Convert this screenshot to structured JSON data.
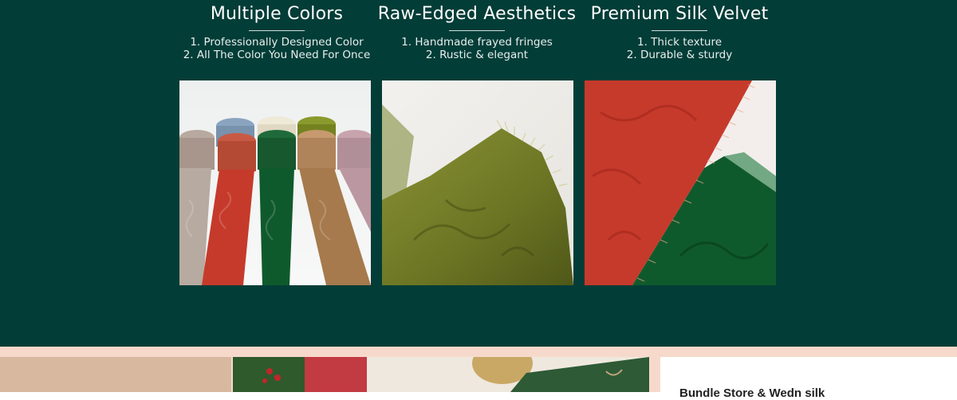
{
  "features": [
    {
      "title": "Multiple Colors",
      "lines": [
        "1. Professionally Designed Color",
        "2. All The Color You Need For Once"
      ],
      "image_subject": "rolls of frayed silk velvet ribbon in assorted colors"
    },
    {
      "title": "Raw-Edged Aesthetics",
      "lines": [
        "1. Handmade frayed fringes",
        "2. Rustic & elegant"
      ],
      "image_subject": "close-up of olive green velvet with frayed edge"
    },
    {
      "title": "Premium Silk Velvet",
      "lines": [
        "1. Thick texture",
        "2. Durable & sturdy"
      ],
      "image_subject": "red and green velvet ribbons overlapping"
    }
  ],
  "bottom_card": {
    "partial_text": "Bundle Store & Wedn silk"
  },
  "colors": {
    "top_background": "#033d37",
    "bottom_background": "#f6d9ca",
    "velvet_red": "#c63a2b",
    "velvet_green": "#0f5a2c",
    "velvet_olive": "#6f7a26"
  }
}
